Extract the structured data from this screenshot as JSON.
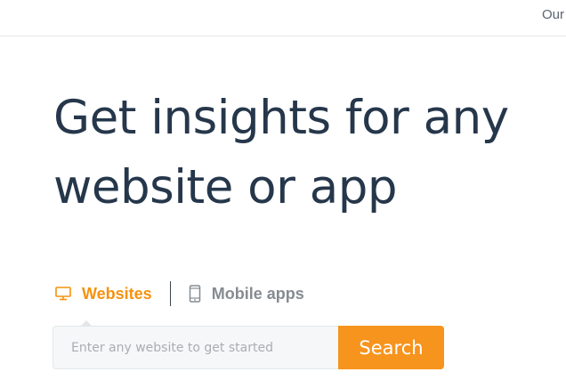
{
  "topbar": {
    "link_label": "Our"
  },
  "hero": {
    "line1": "Get insights for any",
    "line2": "website or app"
  },
  "tabs": [
    {
      "label": "Websites",
      "icon": "monitor-icon",
      "active": true
    },
    {
      "label": "Mobile apps",
      "icon": "mobile-phone-icon",
      "active": false
    }
  ],
  "search": {
    "placeholder": "Enter any website to get started",
    "button_label": "Search"
  },
  "colors": {
    "accent": "#f7941d",
    "heading": "#26374b",
    "inactive_tab": "#868b92"
  }
}
